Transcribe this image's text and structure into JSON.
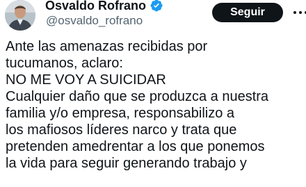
{
  "author": {
    "display_name": "Osvaldo Rofrano",
    "handle": "@osvaldo_rofrano",
    "verified": true,
    "avatar_icon": "profile-photo",
    "verified_icon": "verified-badge-icon",
    "verified_color": "#1d9bf0"
  },
  "actions": {
    "follow_label": "Seguir",
    "more_icon": "more-options-icon"
  },
  "tweet": {
    "lines": [
      "Ante las amenazas recibidas por",
      "tucumanos, aclaro:",
      "NO ME VOY A SUICIDAR",
      "Cualquier daño que se produzca a nuestra",
      "familia y/o empresa, responsabilizo a",
      "los mafiosos líderes narco y trata que",
      "pretenden amedrentar a los que ponemos",
      "la vida para seguir generando trabajo y"
    ]
  }
}
